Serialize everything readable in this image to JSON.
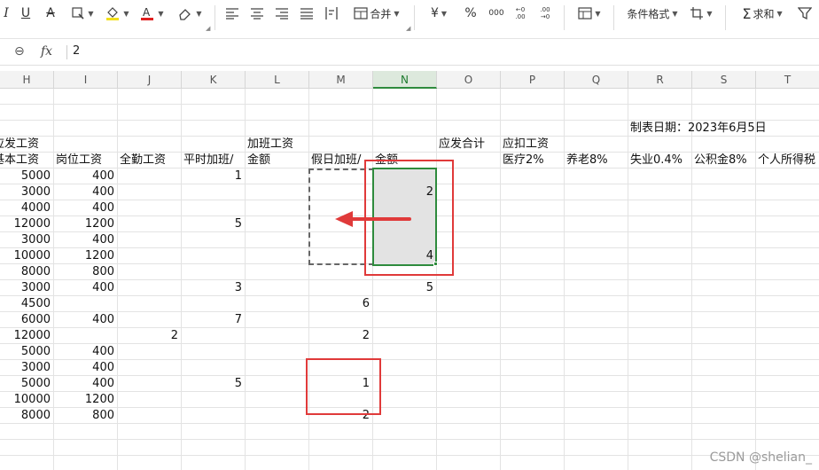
{
  "ribbon": {
    "merge_label": "合并",
    "currency_symbol": "¥",
    "percent_symbol": "%",
    "thousands_label": "000",
    "cond_format_label": "条件格式",
    "sum_label": "求和",
    "dec_inc_label": "←0 .00",
    "dec_dec_label": ".00 →0"
  },
  "formula_bar": {
    "value": "2",
    "fx_label": "fx"
  },
  "columns": [
    "H",
    "I",
    "J",
    "K",
    "L",
    "M",
    "N",
    "O",
    "P",
    "Q",
    "R",
    "S",
    "T"
  ],
  "cells": {
    "date_label": "制表日期：2023年6月5日",
    "h_gross_part": "应发工资",
    "l_overtime_head": "加班工资",
    "o_total": "应发合计",
    "p_deduct": "应扣工资",
    "h_base": "基本工资",
    "i_post": "岗位工资",
    "j_attend": "全勤工资",
    "k_normal_ot": "平时加班/",
    "l_amount": "金额",
    "m_holiday_ot": "假日加班/",
    "n_amount": "金额",
    "p_medical": "医疗2%",
    "q_pension": "养老8%",
    "r_unemploy": "失业0.4%",
    "s_fund": "公积金8%",
    "t_tax": "个人所得税"
  },
  "rows": {
    "H": [
      "5000",
      "3000",
      "4000",
      "12000",
      "3000",
      "10000",
      "8000",
      "3000",
      "4500",
      "6000",
      "12000",
      "5000",
      "3000",
      "5000",
      "10000",
      "8000"
    ],
    "I": [
      "400",
      "400",
      "400",
      "1200",
      "400",
      "1200",
      "800",
      "400",
      "",
      "400",
      "",
      "400",
      "400",
      "400",
      "1200",
      "800"
    ],
    "J": [
      "",
      "",
      "",
      "",
      "",
      "",
      "",
      "",
      "",
      "",
      "2",
      "",
      "",
      "",
      "",
      ""
    ],
    "K": [
      "1",
      "",
      "",
      "5",
      "",
      "",
      "",
      "3",
      "",
      "7",
      "",
      "",
      "",
      "5",
      "",
      ""
    ],
    "M": [
      "",
      "",
      "",
      "",
      "",
      "",
      "",
      "",
      "6",
      "",
      "2",
      "",
      "",
      "1",
      "",
      "2"
    ],
    "N": [
      "",
      "2",
      "",
      "",
      "",
      "4",
      "",
      "5",
      "",
      "",
      "",
      "",
      "",
      "",
      "",
      ""
    ]
  },
  "watermark": "CSDN @shelian_",
  "colors": {
    "selection_green": "#2e8b3d",
    "annotation_red": "#e03a3a"
  }
}
